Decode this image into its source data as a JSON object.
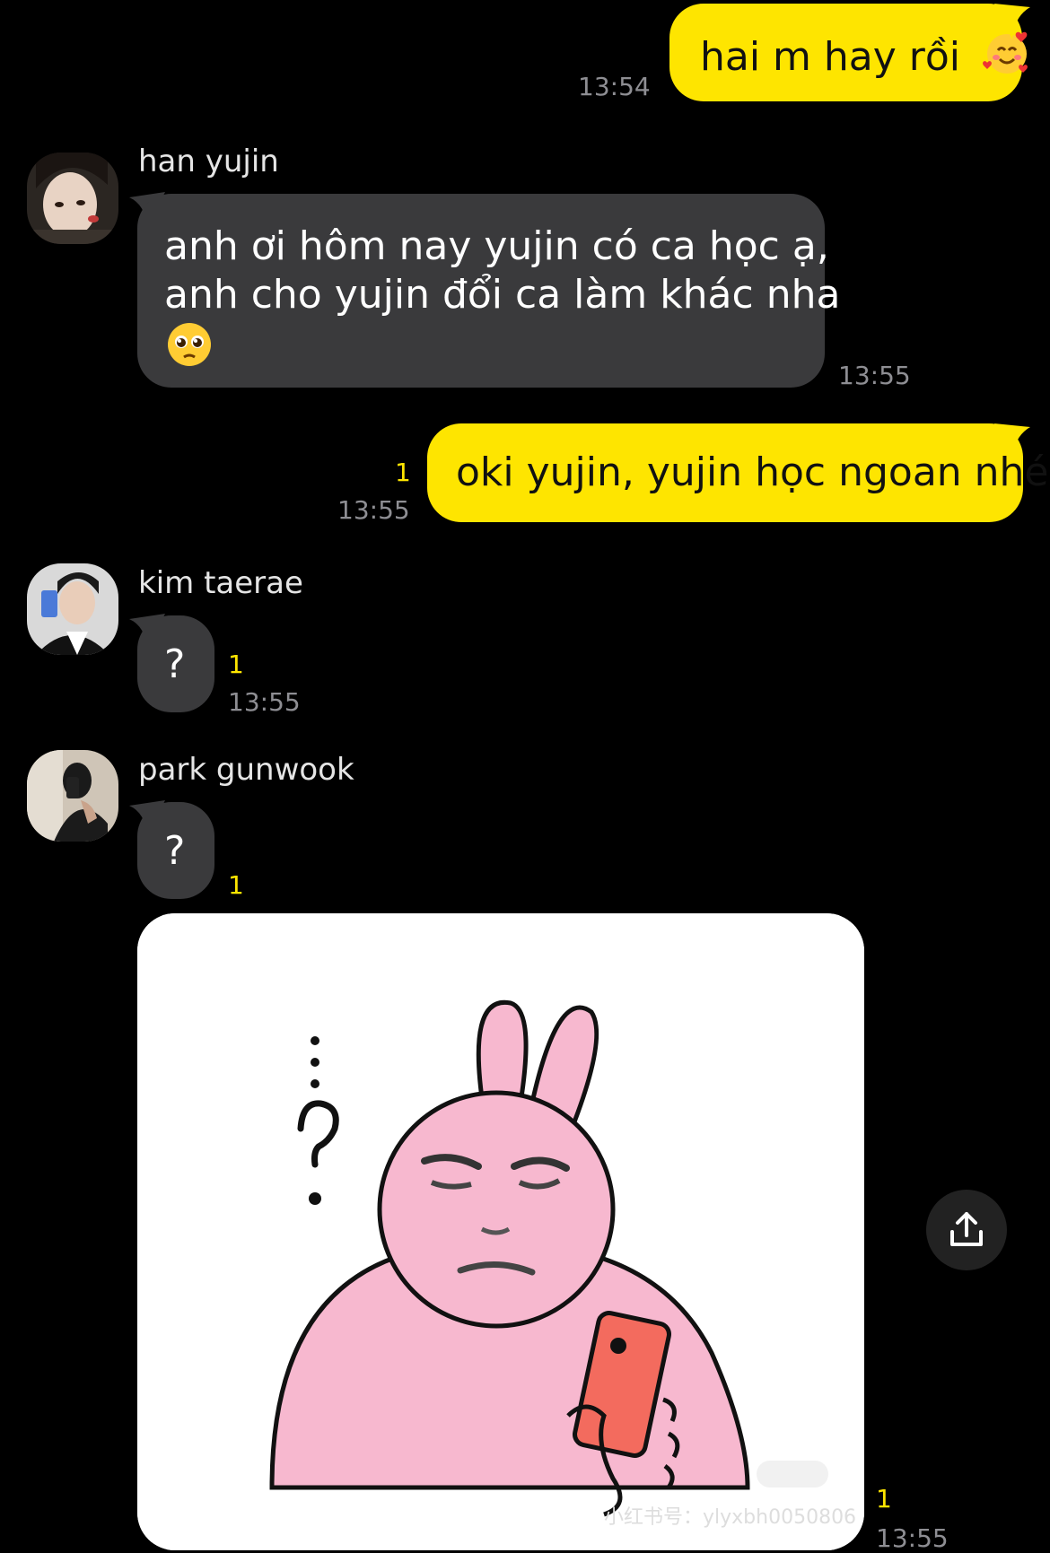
{
  "messages": [
    {
      "id": "m1",
      "sender": "me",
      "text": "hai m hay rồi",
      "emoji": "smiling-face-with-hearts-emoji",
      "time": "13:54"
    },
    {
      "id": "m2",
      "sender": "han yujin",
      "text_line1": "anh ơi hôm nay yujin có ca học ạ,",
      "text_line2": "anh cho yujin đổi ca làm khác nha",
      "emoji": "pleading-face-emoji",
      "time": "13:55"
    },
    {
      "id": "m3",
      "sender": "me",
      "text": "oki yujin, yujin học ngoan nhé",
      "unread": "1",
      "time": "13:55"
    },
    {
      "id": "m4",
      "sender": "kim taerae",
      "text": "?",
      "unread": "1",
      "time": "13:55"
    },
    {
      "id": "m5",
      "sender": "park gunwook",
      "text": "?",
      "unread": "1"
    },
    {
      "id": "m6",
      "sender": "park gunwook",
      "type": "sticker",
      "sticker_desc_icon": "pink-rabbit-question-sticker",
      "unread": "1",
      "time": "13:55",
      "watermark": "小红书号：ylyxbh0050806"
    }
  ],
  "colors": {
    "my_bubble": "#fee500",
    "their_bubble": "#3a3a3c",
    "background": "#000000",
    "unread": "#fee500"
  }
}
